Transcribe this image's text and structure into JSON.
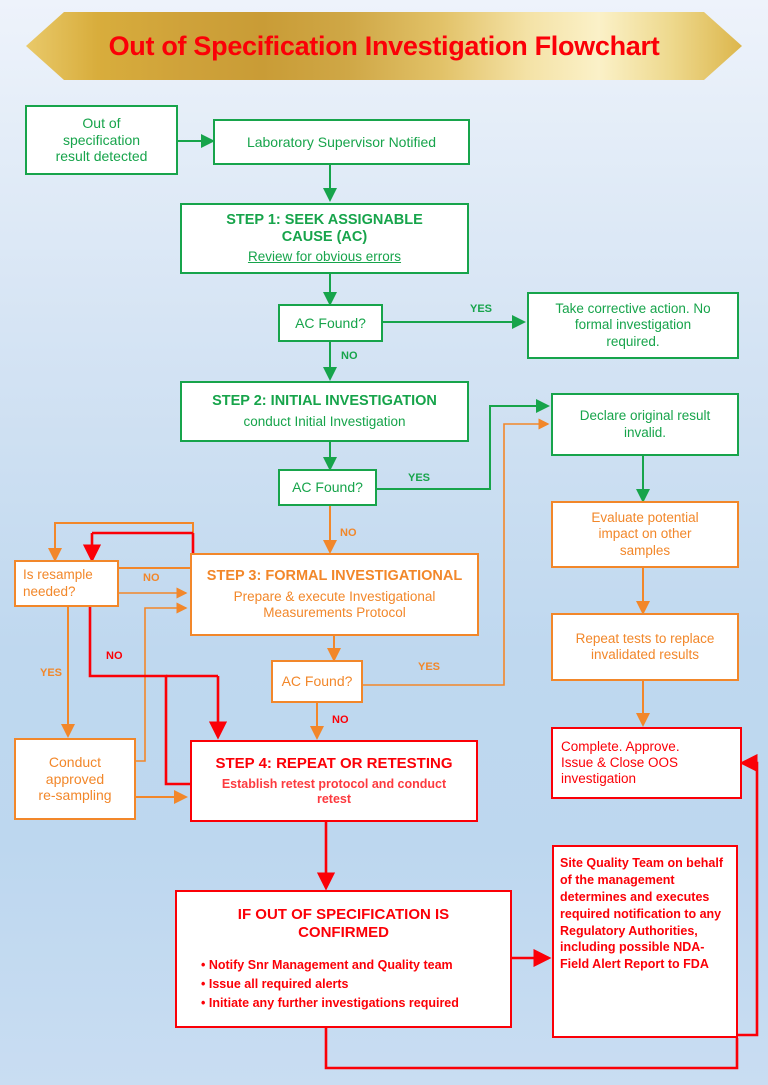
{
  "header": {
    "title": "Out of Specification Investigation Flowchart",
    "banner_color": "#d8ad3c",
    "title_color": "#fb0007"
  },
  "colors": {
    "green": "#17a44b",
    "orange": "#f2872a",
    "red": "#fb0007",
    "background_top": "#eef3fb",
    "background_bottom": "#c3daf0"
  },
  "nodes": {
    "oos_detected": {
      "text": "Out of\nspecification\nresult detected"
    },
    "lab_supervisor": {
      "text": "Laboratory Supervisor Notified"
    },
    "step1": {
      "title": "STEP 1: SEEK  ASSIGNABLE\nCAUSE (AC)",
      "subtitle": "Review for obvious errors"
    },
    "ac_found_1": {
      "text": "AC Found?"
    },
    "corrective_action": {
      "text": "Take corrective action. No\nformal investigation\nrequired."
    },
    "step2": {
      "title": "STEP 2: INITIAL INVESTIGATION",
      "subtitle": "conduct Initial Investigation"
    },
    "ac_found_2": {
      "text": "AC Found?"
    },
    "declare_invalid": {
      "text": "Declare original result\ninvalid."
    },
    "evaluate_impact": {
      "text": "Evaluate potential\nimpact on other\nsamples"
    },
    "repeat_tests": {
      "text": "Repeat tests to replace\ninvalidated results"
    },
    "complete_approve": {
      "text": "Complete. Approve.\nIssue & Close OOS\ninvestigation"
    },
    "is_resample": {
      "text": "Is resample\nneeded?"
    },
    "step3": {
      "title": "STEP 3: FORMAL INVESTIGATIONAL",
      "subtitle": "Prepare & execute Investigational\nMeasurements Protocol"
    },
    "ac_found_3": {
      "text": "AC Found?"
    },
    "conduct_resampling": {
      "text": "Conduct\napproved\nre-sampling"
    },
    "step4": {
      "title": "STEP 4: REPEAT OR RETESTING",
      "subtitle": "Establish retest protocol and  conduct\nretest"
    },
    "oos_confirmed": {
      "title": "IF OUT OF SPECIFICATION  IS\nCONFIRMED",
      "bullets": [
        "Notify Snr Management  and Quality team",
        "Issue all required alerts",
        "Initiate any further  investigations required"
      ]
    },
    "site_quality_team": {
      "text": "Site Quality Team  on behalf of the management determines and executes required notification to any Regulatory Authorities, including possible NDA-Field Alert Report to FDA"
    }
  },
  "edge_labels": {
    "yes_1": "YES",
    "no_1": "NO",
    "yes_2": "YES",
    "no_2": "NO",
    "no_resample": "NO",
    "yes_resample": "YES",
    "no_resample_red": "NO",
    "yes_3": "YES",
    "no_3": "NO"
  }
}
